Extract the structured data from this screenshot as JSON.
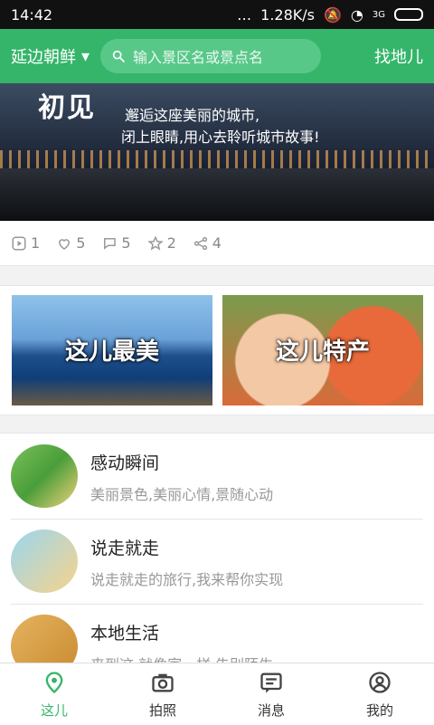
{
  "status_bar": {
    "time": "14:42",
    "network_speed": "1.28K/s",
    "signal": "3G",
    "icons": [
      "wifi-icon",
      "bell-mute-icon",
      "signal-icon",
      "battery-icon"
    ]
  },
  "header": {
    "city": "延边朝鲜",
    "search_placeholder": "输入景区名或景点名",
    "find_label": "找地儿",
    "accent_color": "#35b56a"
  },
  "banner": {
    "title": "初见",
    "line1": "邂逅这座美丽的城市,",
    "line2": "闭上眼睛,用心去聆听城市故事!"
  },
  "stats": [
    {
      "icon": "play-icon",
      "value": "1"
    },
    {
      "icon": "heart-icon",
      "value": "5"
    },
    {
      "icon": "comment-icon",
      "value": "5"
    },
    {
      "icon": "star-icon",
      "value": "2"
    },
    {
      "icon": "share-icon",
      "value": "4"
    }
  ],
  "promo_tiles": [
    {
      "label": "这儿最美"
    },
    {
      "label": "这儿特产"
    }
  ],
  "list_items": [
    {
      "name": "感动瞬间",
      "desc": "美丽景色,美丽心情,景随心动"
    },
    {
      "name": "说走就走",
      "desc": "说走就走的旅行,我来帮你实现"
    },
    {
      "name": "本地生活",
      "desc": "来到这,就像家一样,告别陌生"
    }
  ],
  "tabs": [
    {
      "label": "这儿",
      "icon": "location-icon",
      "active": true
    },
    {
      "label": "拍照",
      "icon": "camera-icon",
      "active": false
    },
    {
      "label": "消息",
      "icon": "message-icon",
      "active": false
    },
    {
      "label": "我的",
      "icon": "profile-icon",
      "active": false
    }
  ]
}
